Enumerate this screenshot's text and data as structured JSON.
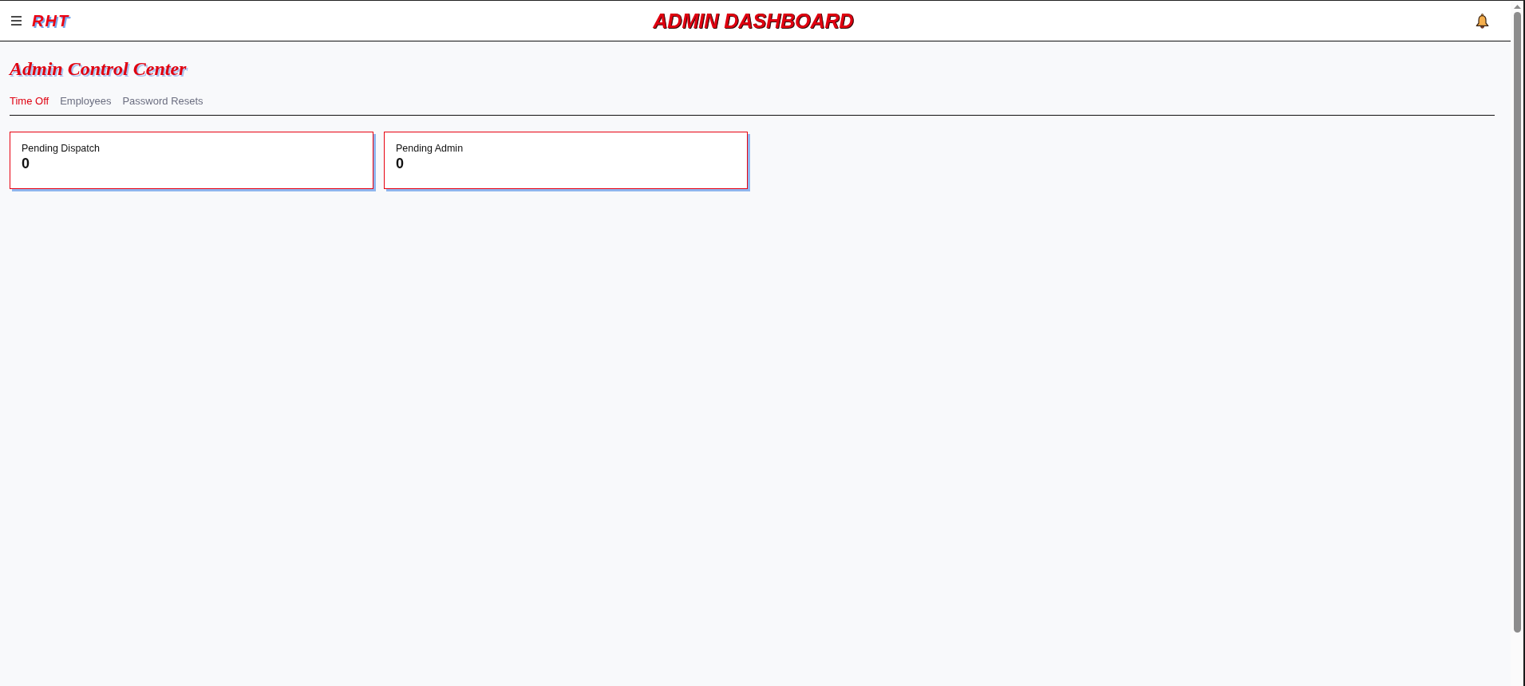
{
  "header": {
    "logo": "RHT",
    "title": "ADMIN DASHBOARD"
  },
  "page_title": "Admin Control Center",
  "tabs": [
    {
      "label": "Time Off",
      "selected": true
    },
    {
      "label": "Employees",
      "selected": false
    },
    {
      "label": "Password Resets",
      "selected": false
    }
  ],
  "cards": [
    {
      "label": "Pending Dispatch",
      "value": "0"
    },
    {
      "label": "Pending Admin",
      "value": "0"
    }
  ]
}
